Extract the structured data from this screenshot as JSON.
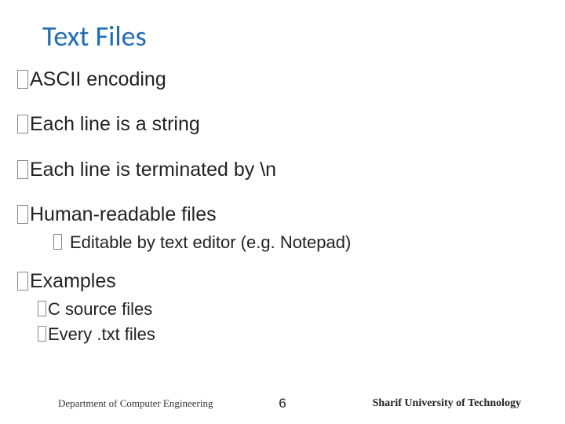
{
  "title": "Text Files",
  "bullets": {
    "b1": "ASCII encoding",
    "b2": "Each line is a string",
    "b3": "Each line is terminated by \\n",
    "b4": "Human-readable files",
    "b4a": "Editable by text editor (e.g. Notepad)",
    "b5": "Examples",
    "b5a": "C source files",
    "b5b": "Every .txt files"
  },
  "footer": {
    "left": "Department of Computer Engineering",
    "page": "6",
    "right": "Sharif University of Technology"
  }
}
